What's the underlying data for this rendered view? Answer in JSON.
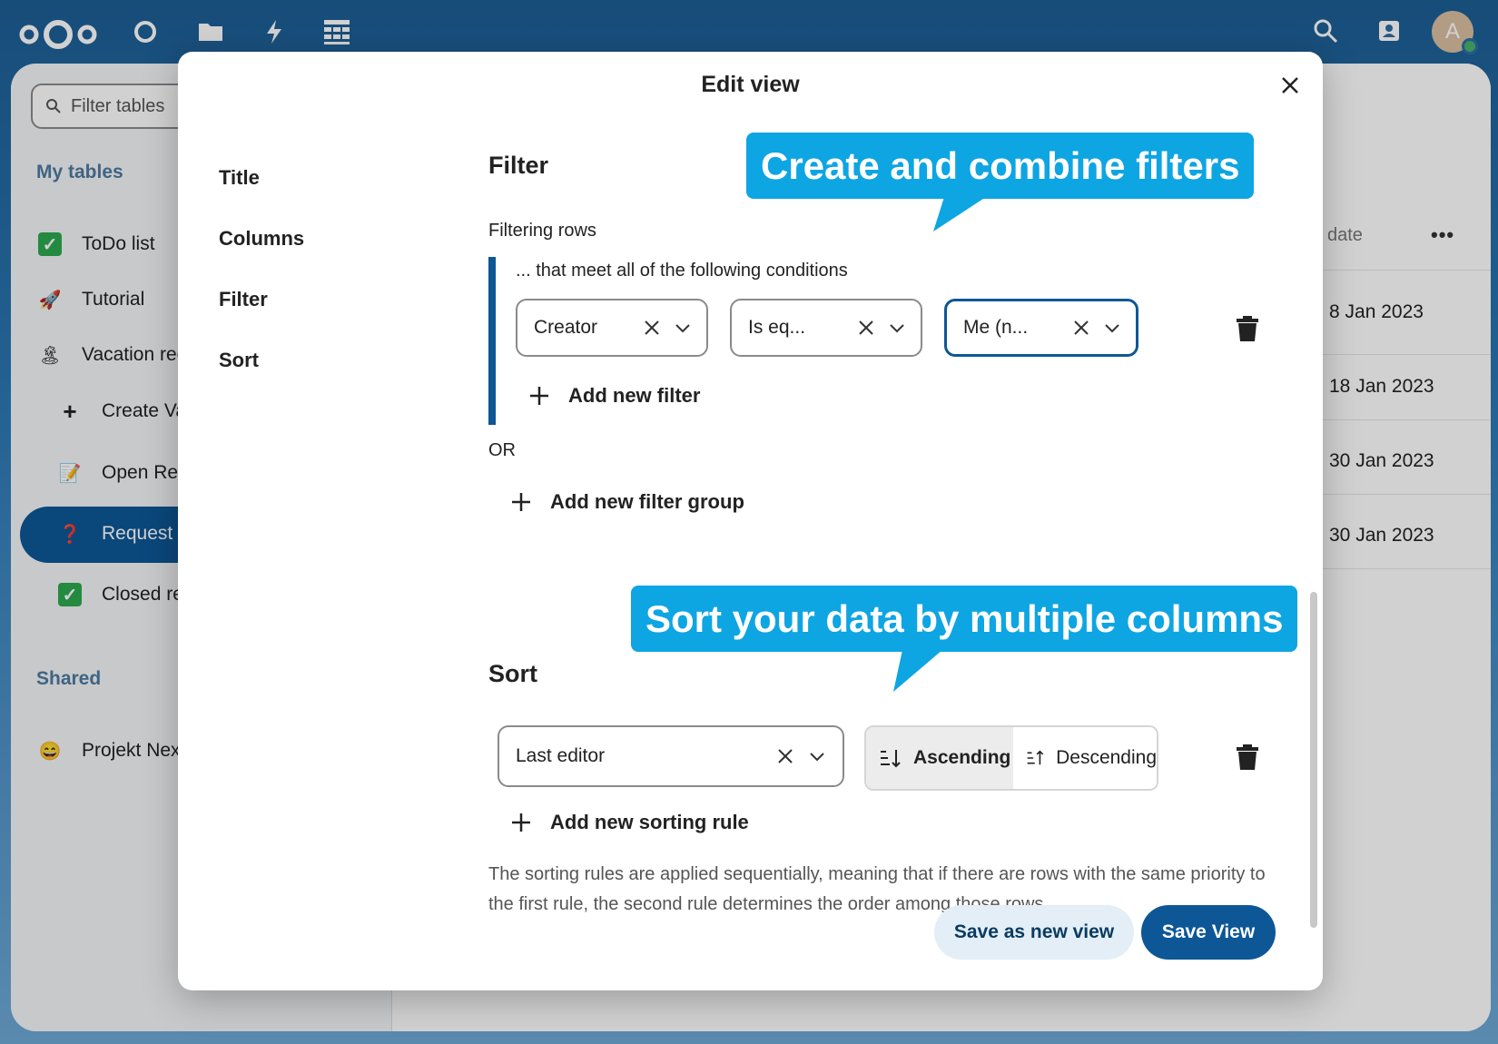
{
  "topbar": {
    "logo": "nextcloud-logo",
    "apps": [
      "dashboard-icon",
      "files-icon",
      "activity-icon",
      "tables-icon"
    ],
    "right": [
      "search-icon",
      "contacts-icon"
    ],
    "avatar_initial": "A"
  },
  "sidebar": {
    "filter_placeholder": "Filter tables",
    "my_tables_heading": "My tables",
    "items": [
      {
        "emoji": "✓",
        "label": "ToDo list"
      },
      {
        "emoji": "🚀",
        "label": "Tutorial"
      },
      {
        "emoji": "🏝",
        "label": "Vacation rec"
      },
      {
        "emoji": "+",
        "label": "Create Va"
      },
      {
        "emoji": "📝",
        "label": "Open Rec"
      },
      {
        "emoji": "❓",
        "label": "Request S"
      },
      {
        "emoji": "✓",
        "label": "Closed re"
      }
    ],
    "shared_heading": "Shared",
    "shared_items": [
      {
        "emoji": "😄",
        "label": "Projekt Next"
      }
    ]
  },
  "background_table": {
    "column_header": "date",
    "more": "•••",
    "dates": [
      "8 Jan 2023",
      "18 Jan 2023",
      "30 Jan 2023",
      "30 Jan 2023"
    ]
  },
  "modal": {
    "title": "Edit view",
    "nav": [
      "Title",
      "Columns",
      "Filter",
      "Sort"
    ],
    "filter": {
      "heading": "Filter",
      "subheading": "Filtering rows",
      "group_caption": "... that meet all of the following conditions",
      "conditions": [
        {
          "value": "Creator"
        },
        {
          "value": "Is eq..."
        },
        {
          "value": "Me (n..."
        }
      ],
      "add_filter": "Add new filter",
      "or_label": "OR",
      "add_group": "Add new filter group"
    },
    "sort": {
      "heading": "Sort",
      "column": "Last editor",
      "ascending": "Ascending",
      "descending": "Descending",
      "add_rule": "Add new sorting rule",
      "help": "The sorting rules are applied sequentially, meaning that if there are rows with the same priority to the first rule, the second rule determines the order among those rows."
    },
    "buttons": {
      "save_new": "Save as new view",
      "save": "Save View"
    }
  },
  "callouts": {
    "filters": "Create and combine filters",
    "sort": "Sort your data by multiple columns"
  },
  "colors": {
    "primary": "#0d5796",
    "callout": "#0ea5e3"
  }
}
